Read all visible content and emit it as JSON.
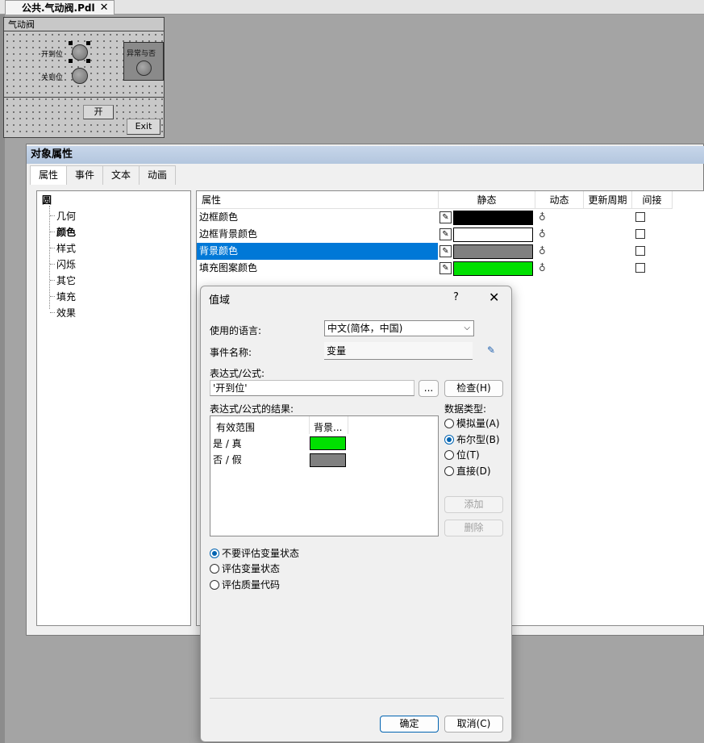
{
  "document_tab": {
    "title": "公共.气动阀.Pdl",
    "close_glyph": "✕"
  },
  "valve": {
    "title": "气动阀",
    "label_open": "开到位",
    "label_closed": "关到位",
    "fault_label": "异常与否",
    "button_open": "开",
    "button_exit": "Exit"
  },
  "properties": {
    "title": "对象属性",
    "tabs": [
      "属性",
      "事件",
      "文本",
      "动画"
    ],
    "tree": {
      "root": "圆",
      "children": [
        "几何",
        "颜色",
        "样式",
        "闪烁",
        "其它",
        "填充",
        "效果"
      ]
    },
    "grid": {
      "columns": [
        "属性",
        "静态",
        "动态",
        "更新周期",
        "间接"
      ],
      "rows": [
        {
          "name": "边框颜色",
          "color": "#000000"
        },
        {
          "name": "边框背景颜色",
          "color": "#ffffff"
        },
        {
          "name": "背景颜色",
          "color": "#808080"
        },
        {
          "name": "填充图案颜色",
          "color": "#00e000"
        }
      ]
    }
  },
  "dialog": {
    "title": "值域",
    "help_glyph": "?",
    "close_glyph": "✕",
    "language_label": "使用的语言:",
    "language_value": "中文(简体，中国)",
    "event_label": "事件名称:",
    "event_value": "变量",
    "expr_label": "表达式/公式:",
    "expr_value": "'开到位'",
    "browse_label": "...",
    "check_label": "检查(H)",
    "result_label": "表达式/公式的结果:",
    "result_columns": [
      "有效范围",
      "背景..."
    ],
    "result_rows": [
      {
        "range": "是 / 真",
        "color": "#00e000"
      },
      {
        "range": "否 / 假",
        "color": "#808080"
      }
    ],
    "datatype_label": "数据类型:",
    "datatypes": [
      "模拟量(A)",
      "布尔型(B)",
      "位(T)",
      "直接(D)"
    ],
    "selected_datatype_index": 1,
    "add_label": "添加",
    "delete_label": "删除",
    "eval_options": [
      "不要评估变量状态",
      "评估变量状态",
      "评估质量代码"
    ],
    "selected_eval_index": 0,
    "ok_label": "确定",
    "cancel_label": "取消(C)"
  }
}
